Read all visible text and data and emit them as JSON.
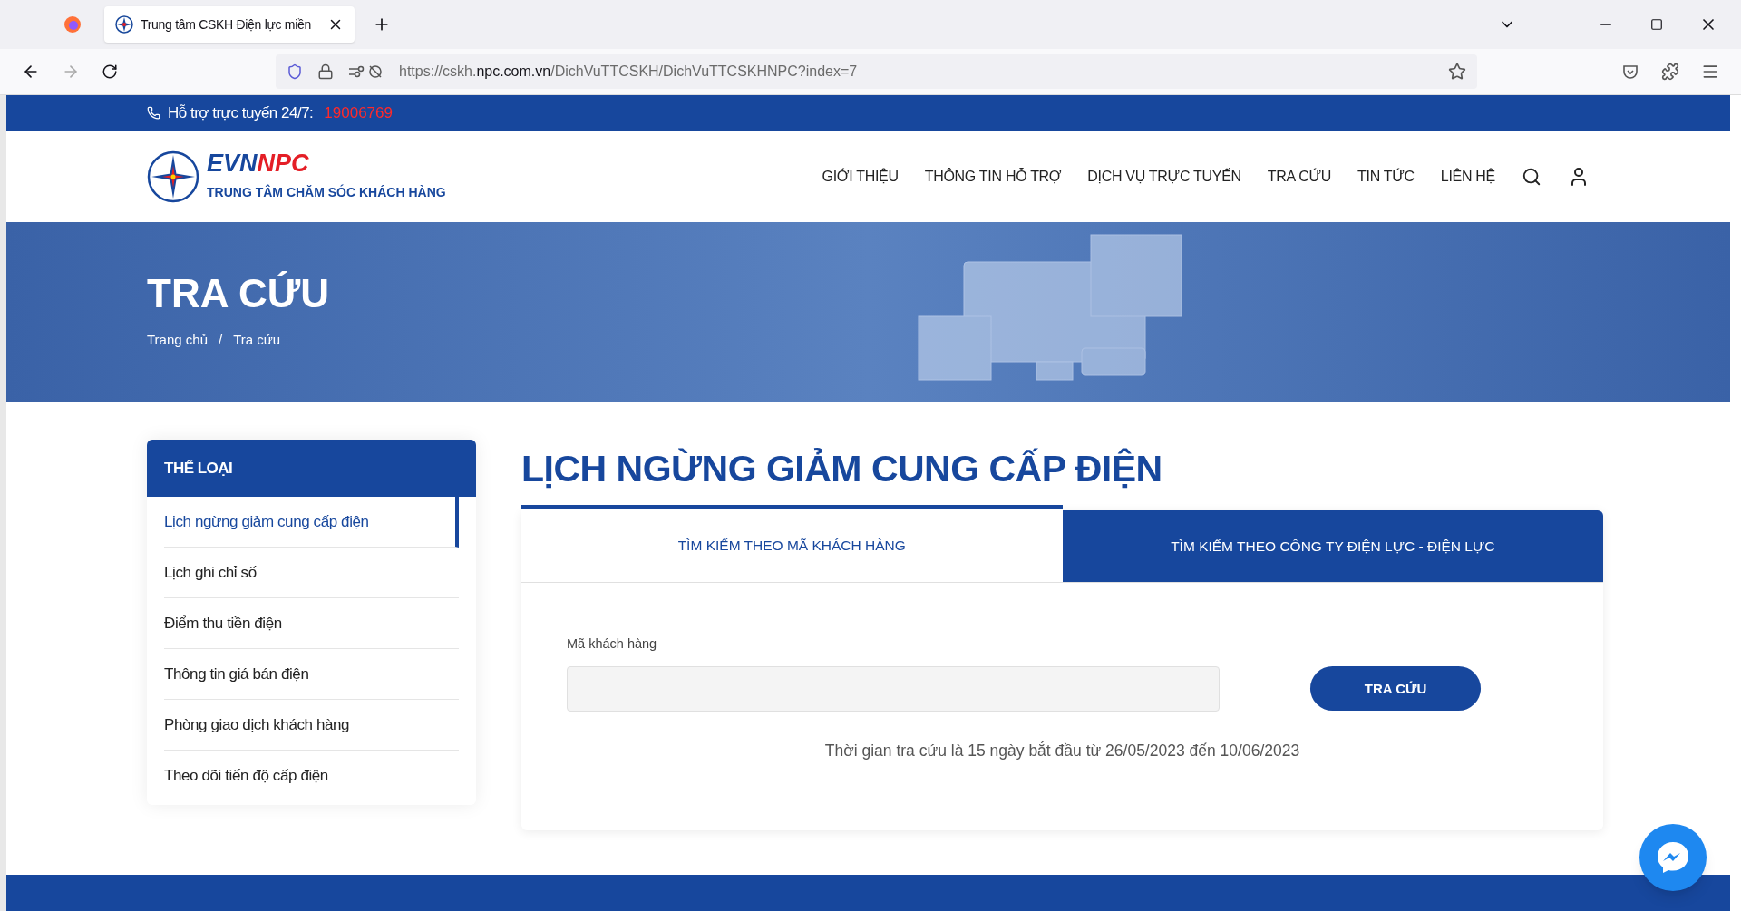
{
  "browser": {
    "tab_title": "Trung tâm CSKH Điện lực miền",
    "url_prefix": "https://cskh.",
    "url_domain": "npc.com.vn",
    "url_path": "/DichVuTTCSKH/DichVuTTCSKHNPC?index=7"
  },
  "topbar": {
    "label": "Hỗ trợ trực tuyến 24/7:",
    "phone": "19006769"
  },
  "header": {
    "logo_main": "EVN",
    "logo_accent": "NPC",
    "logo_subtitle": "TRUNG TÂM CHĂM SÓC KHÁCH HÀNG",
    "nav": [
      "GIỚI THIỆU",
      "THÔNG TIN HỖ TRỢ",
      "DỊCH VỤ TRỰC TUYẾN",
      "TRA CỨU",
      "TIN TỨC",
      "LIÊN HỆ"
    ]
  },
  "banner": {
    "title": "TRA CỨU",
    "breadcrumb": [
      "Trang chủ",
      "Tra cứu"
    ],
    "separator": "/"
  },
  "sidebar": {
    "title": "THỂ LOẠI",
    "items": [
      {
        "label": "Lịch ngừng giảm cung cấp điện",
        "selected": true
      },
      {
        "label": "Lịch ghi chỉ số",
        "selected": false
      },
      {
        "label": "Điểm thu tiền điện",
        "selected": false
      },
      {
        "label": "Thông tin giá bán điện",
        "selected": false
      },
      {
        "label": "Phòng giao dịch khách hàng",
        "selected": false
      },
      {
        "label": "Theo dõi tiến độ cấp điện",
        "selected": false
      }
    ]
  },
  "main": {
    "title": "LỊCH NGỪNG GIẢM CUNG CẤP ĐIỆN",
    "tabs": [
      {
        "label": "TÌM KIẾM THEO MÃ KHÁCH HÀNG",
        "selected": true
      },
      {
        "label": "TÌM KIẾM THEO CÔNG TY ĐIỆN LỰC - ĐIỆN LỰC",
        "selected": false
      }
    ],
    "field_label": "Mã khách hàng",
    "button": "TRA CỨU",
    "note": "Thời gian tra cứu là 15 ngày bắt đầu từ 26/05/2023 đến 10/06/2023"
  }
}
